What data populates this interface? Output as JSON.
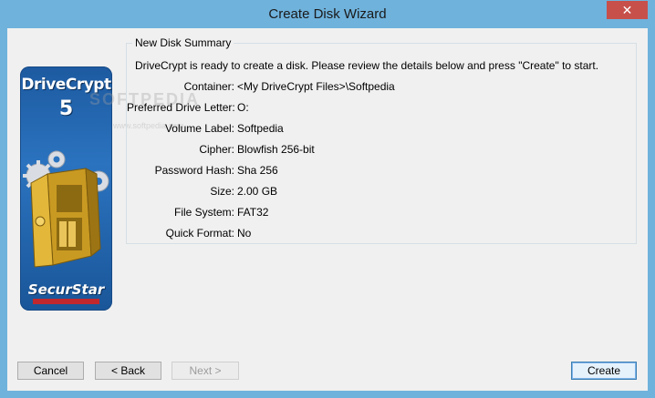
{
  "window": {
    "title": "Create Disk Wizard",
    "close_glyph": "✕"
  },
  "boxart": {
    "product": "DriveCrypt",
    "version": "5",
    "vendor": "SecurStar",
    "watermark": "SOFTPEDIA",
    "watermark_url": "www.softpedia.com"
  },
  "summary": {
    "group_title": "New Disk Summary",
    "intro": "DriveCrypt is ready to create a disk. Please review the details below and press \"Create\" to start.",
    "fields": [
      {
        "label": "Container:",
        "value": "<My DriveCrypt Files>\\Softpedia"
      },
      {
        "label": "Preferred Drive Letter:",
        "value": "O:"
      },
      {
        "label": "Volume Label:",
        "value": "Softpedia"
      },
      {
        "label": "Cipher:",
        "value": "Blowfish 256-bit"
      },
      {
        "label": "Password Hash:",
        "value": "Sha 256"
      },
      {
        "label": "Size:",
        "value": "2.00 GB"
      },
      {
        "label": "File System:",
        "value": "FAT32"
      },
      {
        "label": "Quick Format:",
        "value": "No"
      }
    ]
  },
  "buttons": {
    "cancel": "Cancel",
    "back": "< Back",
    "next": "Next >",
    "create": "Create"
  },
  "colors": {
    "window_frame": "#6fb2dc",
    "close_button": "#c7504b",
    "client_bg": "#f0f0f0"
  }
}
